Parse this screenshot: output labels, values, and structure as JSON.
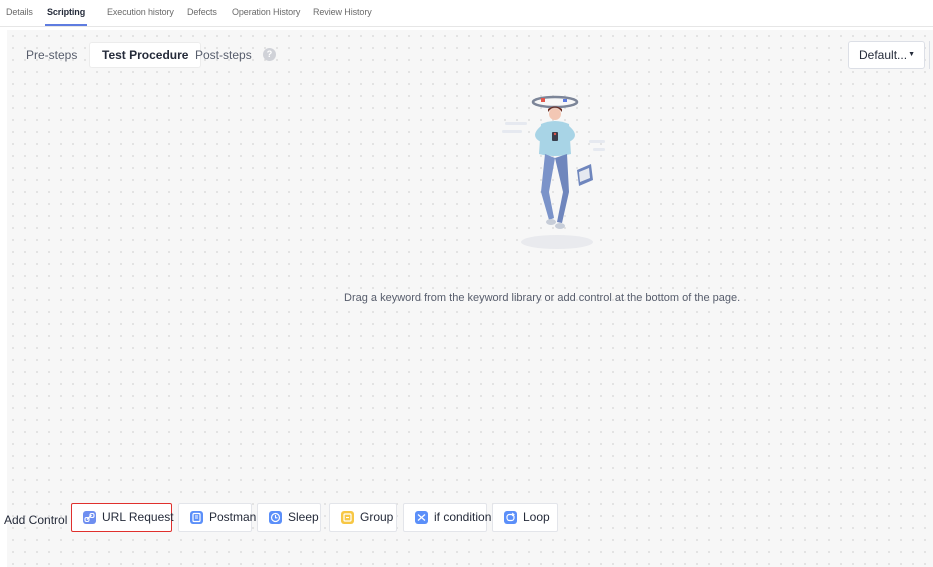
{
  "top_tabs": [
    "Details",
    "Scripting",
    "Execution history",
    "Defects",
    "Operation History",
    "Review History"
  ],
  "sub_tabs": {
    "pre": "Pre-steps",
    "test": "Test Procedure",
    "post": "Post-steps"
  },
  "default_select": "Default...",
  "empty_message": "Drag a keyword from the keyword library or add control at the bottom of the page.",
  "add_control": {
    "label": "Add Control",
    "buttons": [
      {
        "label": "URL Request",
        "icon": "link-icon",
        "color": "#6e8ef0"
      },
      {
        "label": "Postman",
        "icon": "document-icon",
        "color": "#5b8ff9"
      },
      {
        "label": "Sleep",
        "icon": "clock-icon",
        "color": "#5b8ff9"
      },
      {
        "label": "Group",
        "icon": "folder-icon",
        "color": "#f7c744"
      },
      {
        "label": "if condition",
        "icon": "branch-icon",
        "color": "#5b8ff9"
      },
      {
        "label": "Loop",
        "icon": "loop-icon",
        "color": "#5b8ff9"
      }
    ]
  },
  "colors": {
    "accent": "#5e7ce0",
    "highlight_border": "#e0302d"
  }
}
